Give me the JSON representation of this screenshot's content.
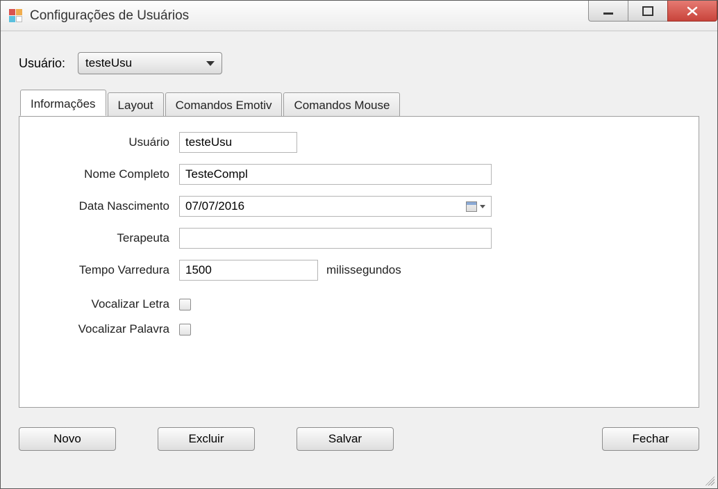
{
  "window": {
    "title": "Configurações de Usuários"
  },
  "top": {
    "user_label": "Usuário:",
    "user_selected": "testeUsu"
  },
  "tabs": {
    "info": "Informações",
    "layout": "Layout",
    "emotiv": "Comandos Emotiv",
    "mouse": "Comandos Mouse"
  },
  "form": {
    "user_label": "Usuário",
    "user_value": "testeUsu",
    "fullname_label": "Nome Completo",
    "fullname_value": "TesteCompl",
    "birth_label": "Data Nascimento",
    "birth_value": "07/07/2016",
    "therapist_label": "Terapeuta",
    "therapist_value": "",
    "scan_label": "Tempo Varredura",
    "scan_value": "1500",
    "scan_unit": "milissegundos",
    "voc_letter_label": "Vocalizar Letra",
    "voc_word_label": "Vocalizar Palavra"
  },
  "buttons": {
    "new": "Novo",
    "delete": "Excluir",
    "save": "Salvar",
    "close": "Fechar"
  }
}
